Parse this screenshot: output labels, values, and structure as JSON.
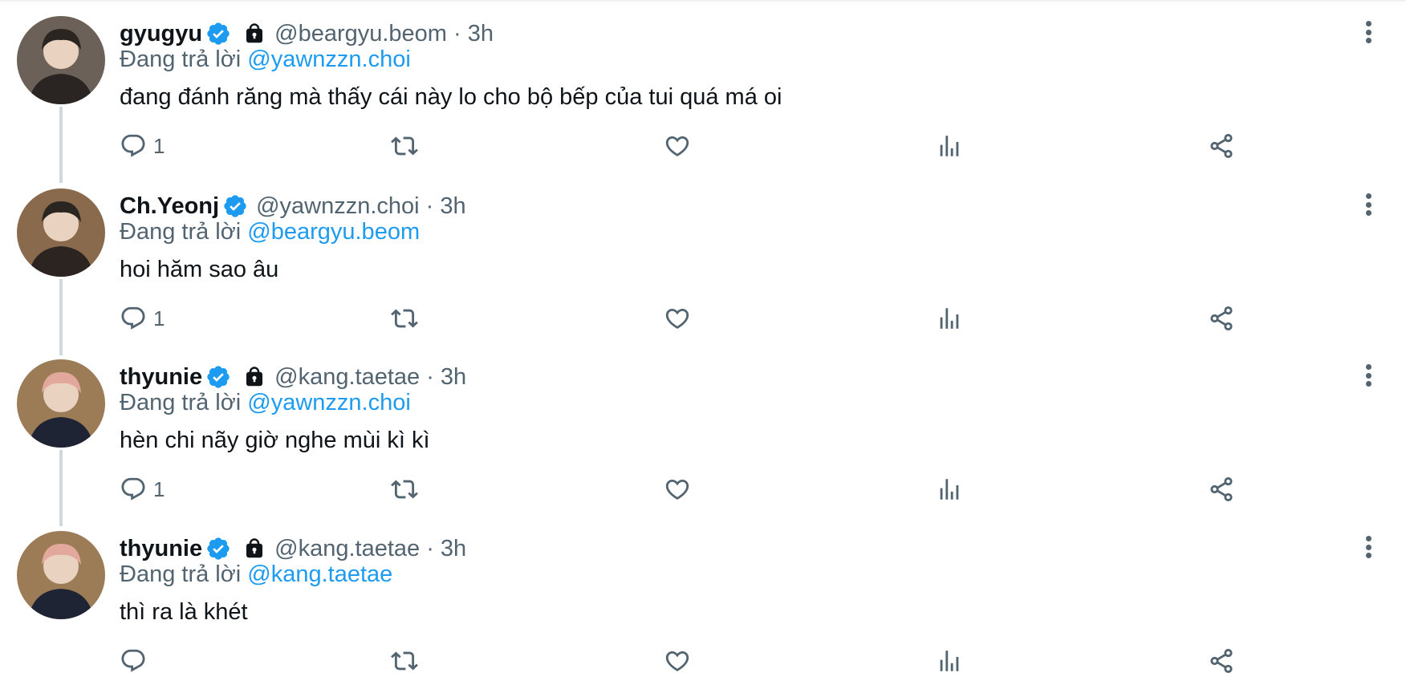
{
  "tweets": [
    {
      "name": "gyugyu",
      "verified": true,
      "locked": true,
      "handle": "@beargyu.beom · 3h",
      "reply_prefix": "Đang trả lời",
      "reply_to": "@yawnzzn.choi",
      "text": "đang đánh răng mà thấy cái này lo cho bộ bếp của tui quá má oi",
      "reply_count": "1",
      "avatar_colors": {
        "bg": "#6b6158",
        "accent": "#2a2522"
      }
    },
    {
      "name": "Ch.Yeonj",
      "verified": true,
      "locked": false,
      "handle": "@yawnzzn.choi · 3h",
      "reply_prefix": "Đang trả lời",
      "reply_to": "@beargyu.beom",
      "text": "hoi hăm sao âu",
      "reply_count": "1",
      "avatar_colors": {
        "bg": "#8a6a4c",
        "accent": "#2b2420"
      }
    },
    {
      "name": "thyunie",
      "verified": true,
      "locked": true,
      "handle": "@kang.taetae · 3h",
      "reply_prefix": "Đang trả lời",
      "reply_to": "@yawnzzn.choi",
      "text": "hèn chi nãy giờ nghe mùi kì kì",
      "reply_count": "1",
      "avatar_colors": {
        "bg": "#9c7b57",
        "accent": "#1f2435"
      }
    },
    {
      "name": "thyunie",
      "verified": true,
      "locked": true,
      "handle": "@kang.taetae · 3h",
      "reply_prefix": "Đang trả lời",
      "reply_to": "@kang.taetae",
      "text": "thì ra là khét",
      "reply_count": "",
      "avatar_colors": {
        "bg": "#9c7b57",
        "accent": "#1f2435"
      }
    }
  ],
  "colors": {
    "link": "#1d9bf0",
    "muted": "#536471",
    "verified": "#1d9bf0"
  },
  "icons": [
    "verified-badge-icon",
    "lock-icon",
    "more-icon",
    "reply-icon",
    "retweet-icon",
    "like-icon",
    "views-icon",
    "share-icon"
  ]
}
